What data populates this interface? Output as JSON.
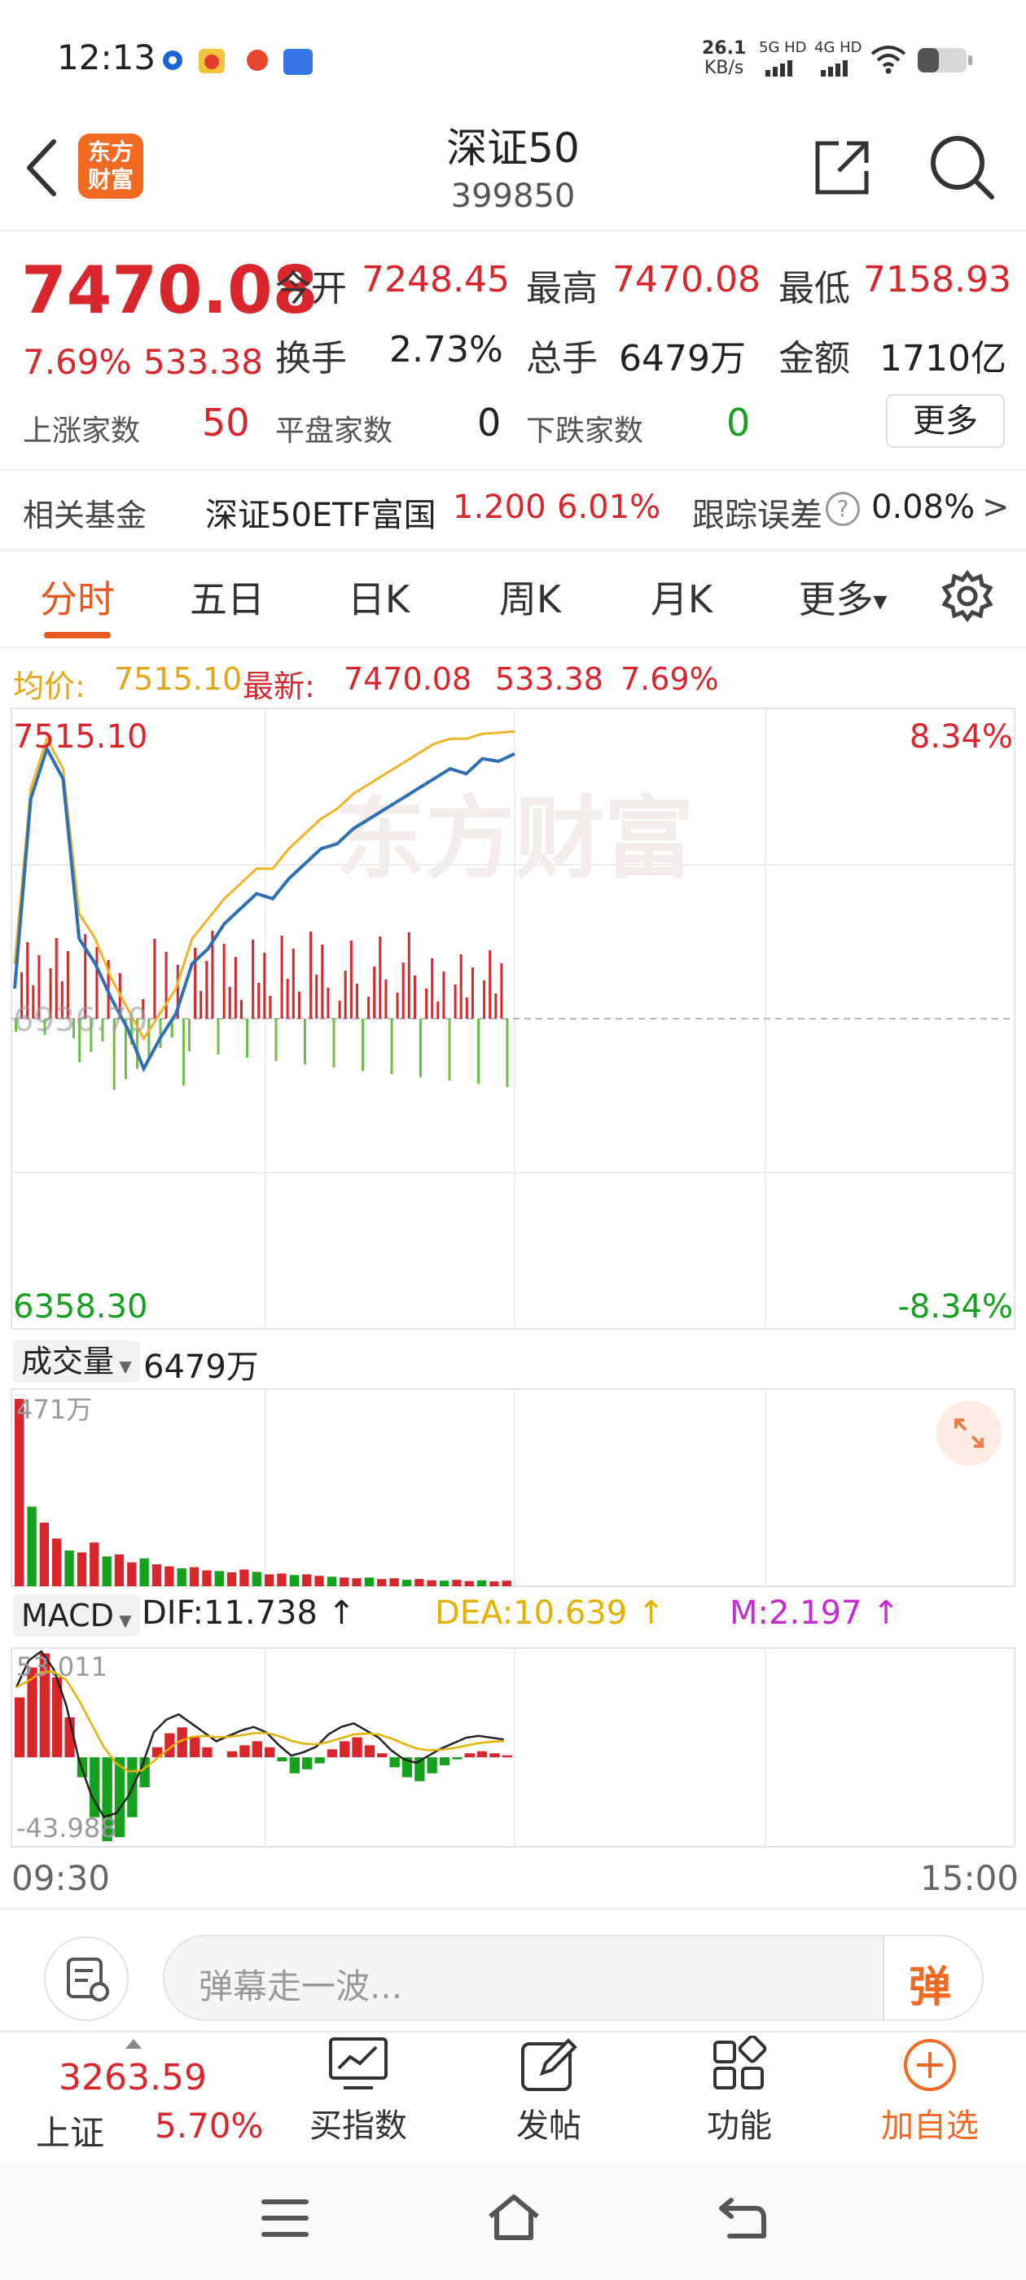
{
  "status_bar": {
    "time": "12:13",
    "net_speed": "26.1",
    "net_unit": "KB/s",
    "sig1": "5G HD",
    "sig2": "4G HD"
  },
  "header": {
    "logo_text1": "东方",
    "logo_text2": "财富",
    "title": "深证50",
    "code": "399850"
  },
  "quote": {
    "price": "7470.08",
    "change_pct": "7.69%",
    "change": "533.38",
    "open_label": "今开",
    "open": "7248.45",
    "high_label": "最高",
    "high": "7470.08",
    "low_label": "最低",
    "low": "7158.93",
    "turnover_label": "换手",
    "turnover": "2.73%",
    "volume_label": "总手",
    "volume": "6479万",
    "amount_label": "金额",
    "amount": "1710亿",
    "up_label": "上涨家数",
    "up": "50",
    "flat_label": "平盘家数",
    "flat": "0",
    "down_label": "下跌家数",
    "down": "0",
    "more": "更多"
  },
  "fund": {
    "label": "相关基金",
    "name": "深证50ETF富国",
    "price": "1.200",
    "pct": "6.01%",
    "tracking_label": "跟踪误差",
    "tracking": "0.08%",
    "arrow": ">"
  },
  "tabs": [
    "分时",
    "五日",
    "日K",
    "周K",
    "月K",
    "更多"
  ],
  "chart_info": {
    "avg_label": "均价:",
    "avg": "7515.10",
    "latest_label": "最新:",
    "latest": "7470.08",
    "change": "533.38",
    "pct": "7.69%"
  },
  "chart_data": [
    {
      "type": "line",
      "title": "",
      "y_labels": {
        "top": "7515.10",
        "mid": "6936.70",
        "bottom": "6358.30",
        "top_pct": "8.34%",
        "bottom_pct": "-8.34%"
      },
      "ylim": [
        6358.3,
        7515.1
      ],
      "x_labels": [
        "09:30",
        "15:00"
      ],
      "series": [
        {
          "name": "最新",
          "values": [
            7000,
            7380,
            7480,
            7420,
            7100,
            7050,
            6980,
            6920,
            6840,
            6900,
            6950,
            7050,
            7080,
            7130,
            7160,
            7190,
            7180,
            7220,
            7250,
            7280,
            7290,
            7320,
            7340,
            7360,
            7380,
            7400,
            7420,
            7440,
            7430,
            7460,
            7455,
            7470
          ]
        },
        {
          "name": "均价",
          "values": [
            7050,
            7400,
            7500,
            7440,
            7150,
            7100,
            7020,
            6960,
            6900,
            6950,
            7000,
            7100,
            7140,
            7180,
            7210,
            7240,
            7240,
            7280,
            7310,
            7340,
            7360,
            7390,
            7410,
            7430,
            7450,
            7470,
            7490,
            7500,
            7500,
            7510,
            7512,
            7515
          ]
        }
      ]
    },
    {
      "type": "bar",
      "title": "成交量",
      "value_label": "6479万",
      "max_label": "471万",
      "values": [
        471,
        200,
        160,
        120,
        90,
        85,
        110,
        75,
        80,
        60,
        70,
        55,
        50,
        45,
        48,
        40,
        38,
        35,
        42,
        36,
        30,
        32,
        28,
        30,
        26,
        24,
        22,
        20,
        22,
        18,
        20,
        16,
        18,
        15,
        14,
        16,
        13,
        15,
        12,
        14
      ]
    },
    {
      "type": "bar",
      "title": "MACD",
      "dif": "DIF:11.738",
      "dea": "DEA:10.639",
      "m": "M:2.197",
      "max_label": "53.011",
      "min_label": "-43.988",
      "values": [
        30,
        45,
        52,
        40,
        20,
        -10,
        -30,
        -42,
        -40,
        -30,
        -15,
        5,
        12,
        15,
        10,
        5,
        0,
        3,
        6,
        8,
        5,
        -2,
        -8,
        -6,
        -3,
        4,
        8,
        10,
        6,
        2,
        -5,
        -10,
        -12,
        -8,
        -4,
        -1,
        2,
        3,
        2,
        1
      ]
    }
  ],
  "volume_label": "成交量",
  "volume_value": "6479万",
  "comment": {
    "placeholder": "弹幕走一波...",
    "danmu": "弹"
  },
  "bottom_nav": {
    "index_price": "3263.59",
    "index_name": "上证",
    "index_pct": "5.70%",
    "buy_index": "买指数",
    "post": "发帖",
    "func": "功能",
    "add": "加自选"
  },
  "watermark": "东方财富",
  "colors": {
    "up": "#d9262c",
    "down": "#15a01e",
    "accent": "#f26a21",
    "line": "#2f6fb3",
    "avg": "#f0b429"
  }
}
